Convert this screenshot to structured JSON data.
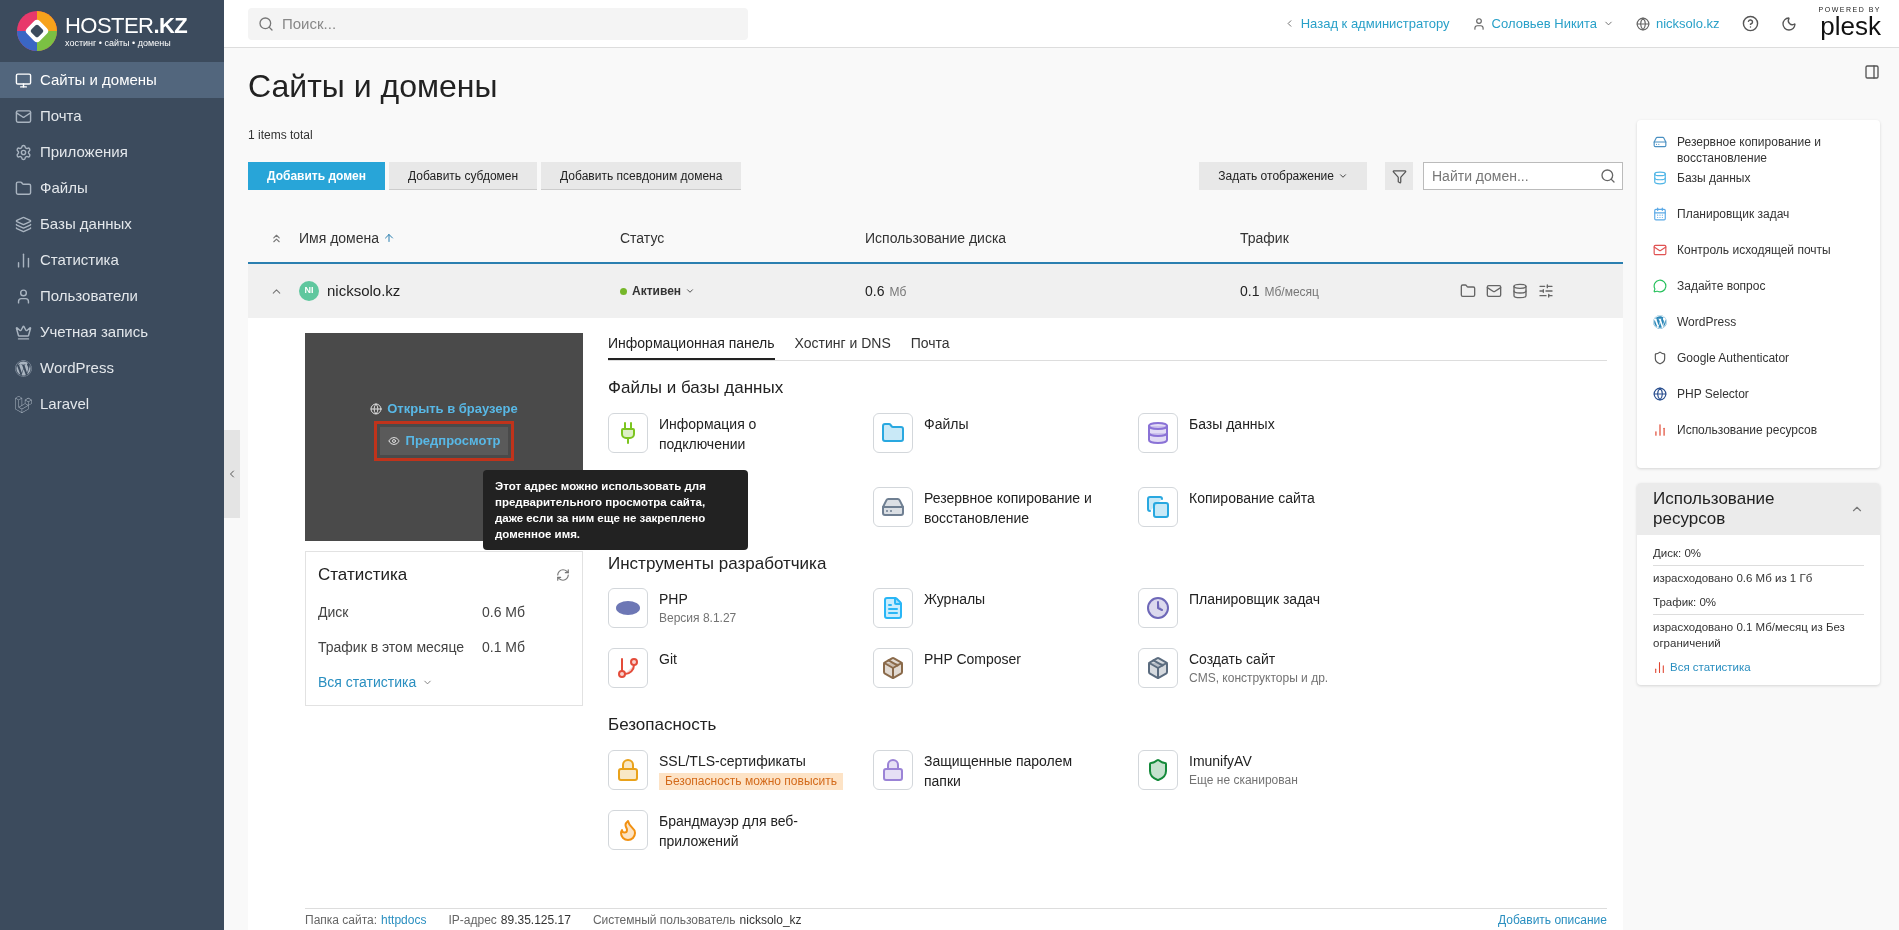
{
  "logo": {
    "brand": "HOSTER",
    "suffix": ".KZ",
    "tagline": "хостинг • сайты • домены"
  },
  "sidebar": {
    "items": [
      {
        "label": "Сайты и домены",
        "selected": true
      },
      {
        "label": "Почта",
        "selected": false
      },
      {
        "label": "Приложения",
        "selected": false
      },
      {
        "label": "Файлы",
        "selected": false
      },
      {
        "label": "Базы данных",
        "selected": false
      },
      {
        "label": "Статистика",
        "selected": false
      },
      {
        "label": "Пользователи",
        "selected": false
      },
      {
        "label": "Учетная запись",
        "selected": false
      },
      {
        "label": "WordPress",
        "selected": false
      },
      {
        "label": "Laravel",
        "selected": false
      }
    ]
  },
  "topbar": {
    "search": {
      "placeholder": "Поиск..."
    },
    "back_link": "Назад к администратору",
    "user": "Соловьев Никита",
    "domain": "nicksolo.kz",
    "powered_by": "POWERED BY",
    "product": "plesk"
  },
  "page": {
    "title": "Сайты и домены",
    "items_total": "1 items total"
  },
  "toolbar": {
    "buttons": [
      {
        "label": "Добавить домен",
        "kind": "primary"
      },
      {
        "label": "Добавить субдомен",
        "kind": "secondary"
      },
      {
        "label": "Добавить псевдоним домена",
        "kind": "secondary"
      }
    ],
    "view_button": "Задать отображение",
    "search": {
      "placeholder": "Найти домен..."
    }
  },
  "table": {
    "columns": [
      {
        "label": "Имя домена",
        "sorted": true
      },
      {
        "label": "Статус",
        "sorted": false
      },
      {
        "label": "Использование диска",
        "sorted": false
      },
      {
        "label": "Трафик",
        "sorted": false
      }
    ],
    "rows": [
      {
        "avatar": "NI",
        "name": "nicksolo.kz",
        "status": "Активен",
        "disk": "0.6",
        "disk_unit": "Мб",
        "traffic": "0.1",
        "traffic_unit": "Мб/месяц",
        "expanded": true
      }
    ]
  },
  "preview": {
    "open_link": "Открыть в браузере",
    "preview_link": "Предпросмотр",
    "tooltip": "Этот адрес можно использовать для предварительного просмотра сайта, даже если за ним еще не закреплено доменное имя."
  },
  "stats": {
    "title": "Статистика",
    "rows": [
      {
        "label": "Диск",
        "value": "0.6 Мб"
      },
      {
        "label": "Трафик в этом месяце",
        "value": "0.1 Мб"
      }
    ],
    "link": "Вся статистика"
  },
  "tabs": [
    {
      "label": "Информационная панель",
      "selected": true
    },
    {
      "label": "Хостинг и DNS",
      "selected": false
    },
    {
      "label": "Почта",
      "selected": false
    }
  ],
  "sections": [
    {
      "title": "Файлы и базы данных",
      "items": [
        {
          "kind": "tool",
          "label": "Информация о подключении"
        },
        {
          "kind": "tool",
          "label": "Файлы"
        },
        {
          "kind": "tool",
          "label": "Базы данных"
        },
        {
          "kind": "covered"
        },
        {
          "kind": "tool",
          "label": "Резервное копирование и восстановление"
        },
        {
          "kind": "tool",
          "label": "Копирование сайта"
        }
      ]
    },
    {
      "title": "Инструменты разработчика",
      "items": [
        {
          "kind": "tool",
          "label": "PHP",
          "sub": "Версия 8.1.27"
        },
        {
          "kind": "tool",
          "label": "Журналы"
        },
        {
          "kind": "tool",
          "label": "Планировщик задач"
        },
        {
          "kind": "tool",
          "label": "Git"
        },
        {
          "kind": "tool",
          "label": "PHP Composer"
        },
        {
          "kind": "tool",
          "label": "Создать сайт",
          "sub": "CMS, конструкторы и др."
        }
      ]
    },
    {
      "title": "Безопасность",
      "items": [
        {
          "kind": "tool",
          "label": "SSL/TLS-сертификаты",
          "badge": "Безопасность можно повысить"
        },
        {
          "kind": "tool",
          "label": "Защищенные паролем папки"
        },
        {
          "kind": "tool",
          "label": "ImunifyAV",
          "sub": "Еще не сканирован"
        },
        {
          "kind": "tool",
          "label": "Брандмауэр для веб-приложений"
        }
      ]
    }
  ],
  "footer": {
    "items": [
      {
        "label": "Папка сайта:",
        "value": "httpdocs",
        "link": true
      },
      {
        "label": "IP-адрес",
        "value": "89.35.125.17",
        "link": false
      },
      {
        "label": "Системный пользователь",
        "value": "nicksolo_kz",
        "link": false
      }
    ],
    "action": "Добавить описание"
  },
  "right_panel": {
    "links": [
      "Резервное копирование и восстановление",
      "Базы данных",
      "Планировщик задач",
      "Контроль исходящей почты",
      "Задайте вопрос",
      "WordPress",
      "Google Authenticator",
      "PHP Selector",
      "Использование ресурсов"
    ],
    "resources": {
      "title": "Использование ресурсов",
      "expanded": true,
      "rows": [
        "Диск: 0%",
        "израсходовано 0.6 Мб из 1 Гб",
        "Трафик: 0%",
        "израсходовано 0.1 Мб/месяц из Без ограничений"
      ],
      "link": "Вся статистика"
    }
  }
}
